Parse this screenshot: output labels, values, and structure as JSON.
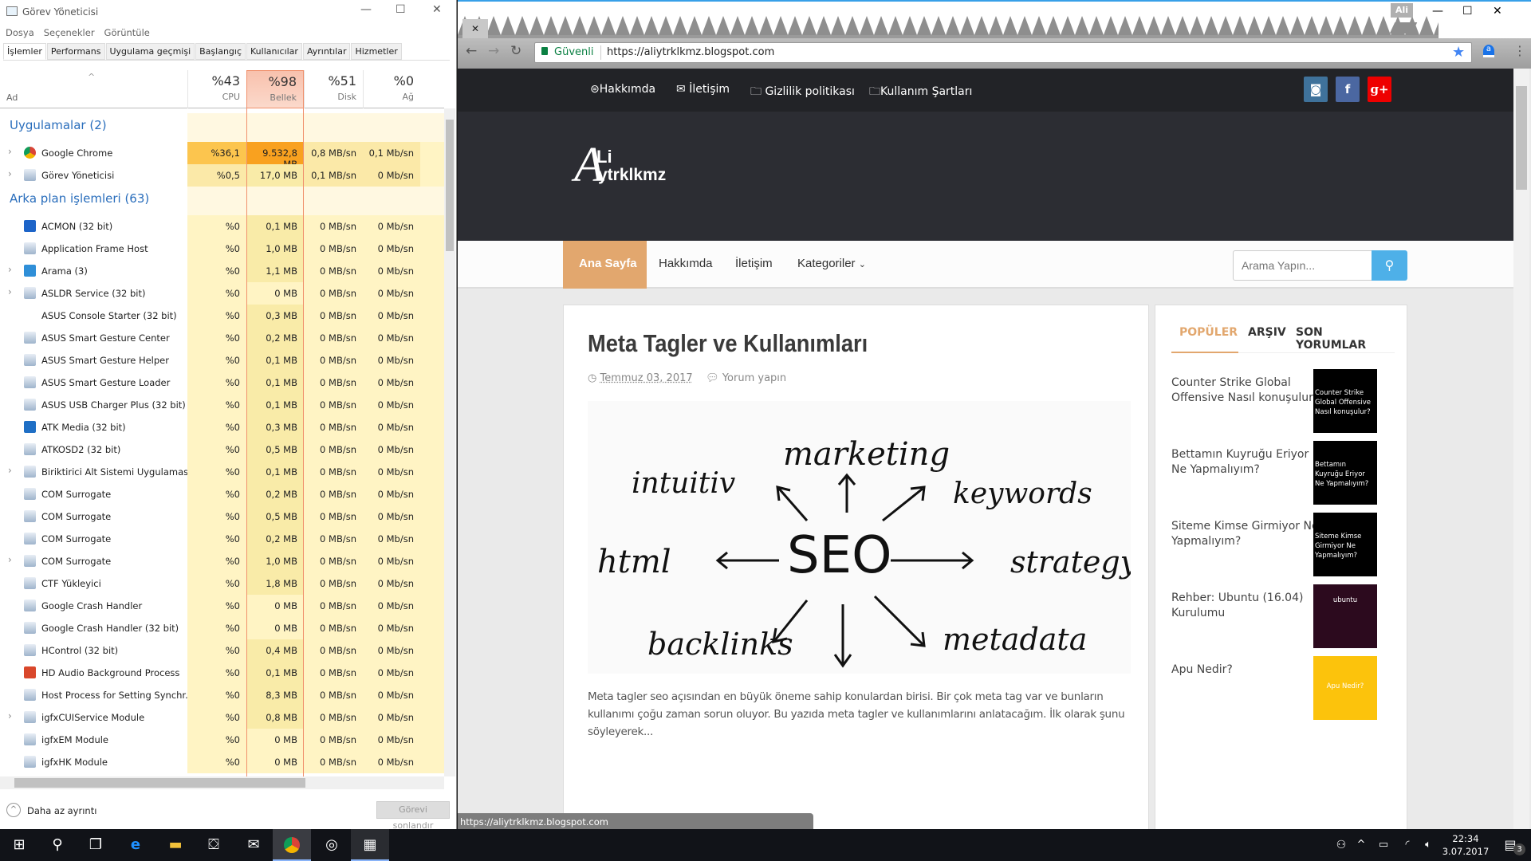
{
  "taskmgr": {
    "title": "Görev Yöneticisi",
    "menu": [
      "Dosya",
      "Seçenekler",
      "Görüntüle"
    ],
    "tabs": [
      "İşlemler",
      "Performans",
      "Uygulama geçmişi",
      "Başlangıç",
      "Kullanıcılar",
      "Ayrıntılar",
      "Hizmetler"
    ],
    "columns": {
      "name": "Ad",
      "cpu": {
        "pct": "%43",
        "label": "CPU"
      },
      "mem": {
        "pct": "%98",
        "label": "Bellek"
      },
      "disk": {
        "pct": "%51",
        "label": "Disk"
      },
      "net": {
        "pct": "%0",
        "label": "Ağ"
      }
    },
    "groups": [
      {
        "title": "Uygulamalar (2)",
        "rows": [
          {
            "name": "Google Chrome",
            "icon": "chrome-icon",
            "expand": true,
            "cpu": "%36,1",
            "mem": "9.532,8 MB",
            "disk": "0,8 MB/sn",
            "net": "0,1 Mb/sn"
          },
          {
            "name": "Görev Yöneticisi",
            "icon": "task-manager-icon",
            "expand": true,
            "cpu": "%0,5",
            "mem": "17,0 MB",
            "disk": "0,1 MB/sn",
            "net": "0 Mb/sn"
          }
        ]
      },
      {
        "title": "Arka plan işlemleri (63)",
        "rows": [
          {
            "name": "ACMON (32 bit)",
            "icon": "acmon-icon",
            "cpu": "%0",
            "mem": "0,1 MB",
            "disk": "0 MB/sn",
            "net": "0 Mb/sn"
          },
          {
            "name": "Application Frame Host",
            "icon": "app-window-icon",
            "cpu": "%0",
            "mem": "1,0 MB",
            "disk": "0 MB/sn",
            "net": "0 Mb/sn"
          },
          {
            "name": "Arama (3)",
            "icon": "search-icon",
            "expand": true,
            "cpu": "%0",
            "mem": "1,1 MB",
            "disk": "0 MB/sn",
            "net": "0 Mb/sn"
          },
          {
            "name": "ASLDR Service (32 bit)",
            "icon": "window-icon",
            "expand": true,
            "cpu": "%0",
            "mem": "0 MB",
            "disk": "0 MB/sn",
            "net": "0 Mb/sn"
          },
          {
            "name": "ASUS Console Starter (32 bit)",
            "icon": "blank-icon",
            "cpu": "%0",
            "mem": "0,3 MB",
            "disk": "0 MB/sn",
            "net": "0 Mb/sn"
          },
          {
            "name": "ASUS Smart Gesture Center",
            "icon": "gesture-icon",
            "cpu": "%0",
            "mem": "0,2 MB",
            "disk": "0 MB/sn",
            "net": "0 Mb/sn"
          },
          {
            "name": "ASUS Smart Gesture Helper",
            "icon": "gesture-icon",
            "cpu": "%0",
            "mem": "0,1 MB",
            "disk": "0 MB/sn",
            "net": "0 Mb/sn"
          },
          {
            "name": "ASUS Smart Gesture Loader",
            "icon": "gesture-loader-icon",
            "cpu": "%0",
            "mem": "0,1 MB",
            "disk": "0 MB/sn",
            "net": "0 Mb/sn"
          },
          {
            "name": "ASUS USB Charger Plus (32 bit)",
            "icon": "usb-icon",
            "cpu": "%0",
            "mem": "0,1 MB",
            "disk": "0 MB/sn",
            "net": "0 Mb/sn"
          },
          {
            "name": "ATK Media (32 bit)",
            "icon": "atk-media-icon",
            "cpu": "%0",
            "mem": "0,3 MB",
            "disk": "0 MB/sn",
            "net": "0 Mb/sn"
          },
          {
            "name": "ATKOSD2 (32 bit)",
            "icon": "atkosd-icon",
            "cpu": "%0",
            "mem": "0,5 MB",
            "disk": "0 MB/sn",
            "net": "0 Mb/sn"
          },
          {
            "name": "Biriktirici Alt Sistemi Uygulaması",
            "icon": "printer-icon",
            "expand": true,
            "cpu": "%0",
            "mem": "0,1 MB",
            "disk": "0 MB/sn",
            "net": "0 Mb/sn"
          },
          {
            "name": "COM Surrogate",
            "icon": "app-window-icon",
            "cpu": "%0",
            "mem": "0,2 MB",
            "disk": "0 MB/sn",
            "net": "0 Mb/sn"
          },
          {
            "name": "COM Surrogate",
            "icon": "app-window-icon",
            "cpu": "%0",
            "mem": "0,5 MB",
            "disk": "0 MB/sn",
            "net": "0 Mb/sn"
          },
          {
            "name": "COM Surrogate",
            "icon": "app-window-icon",
            "cpu": "%0",
            "mem": "0,2 MB",
            "disk": "0 MB/sn",
            "net": "0 Mb/sn"
          },
          {
            "name": "COM Surrogate",
            "icon": "app-window-icon",
            "expand": true,
            "cpu": "%0",
            "mem": "1,0 MB",
            "disk": "0 MB/sn",
            "net": "0 Mb/sn"
          },
          {
            "name": "CTF Yükleyici",
            "icon": "ctf-icon",
            "cpu": "%0",
            "mem": "1,8 MB",
            "disk": "0 MB/sn",
            "net": "0 Mb/sn"
          },
          {
            "name": "Google Crash Handler",
            "icon": "crash-handler-icon",
            "cpu": "%0",
            "mem": "0 MB",
            "disk": "0 MB/sn",
            "net": "0 Mb/sn"
          },
          {
            "name": "Google Crash Handler (32 bit)",
            "icon": "crash-handler-icon",
            "cpu": "%0",
            "mem": "0 MB",
            "disk": "0 MB/sn",
            "net": "0 Mb/sn"
          },
          {
            "name": "HControl (32 bit)",
            "icon": "hcontrol-icon",
            "cpu": "%0",
            "mem": "0,4 MB",
            "disk": "0 MB/sn",
            "net": "0 Mb/sn"
          },
          {
            "name": "HD Audio Background Process",
            "icon": "speaker-icon",
            "cpu": "%0",
            "mem": "0,1 MB",
            "disk": "0 MB/sn",
            "net": "0 Mb/sn"
          },
          {
            "name": "Host Process for Setting Synchr...",
            "icon": "app-window-icon",
            "cpu": "%0",
            "mem": "8,3 MB",
            "disk": "0 MB/sn",
            "net": "0 Mb/sn"
          },
          {
            "name": "igfxCUIService Module",
            "icon": "app-window-icon",
            "expand": true,
            "cpu": "%0",
            "mem": "0,8 MB",
            "disk": "0 MB/sn",
            "net": "0 Mb/sn"
          },
          {
            "name": "igfxEM Module",
            "icon": "app-window-icon",
            "cpu": "%0",
            "mem": "0 MB",
            "disk": "0 MB/sn",
            "net": "0 Mb/sn"
          },
          {
            "name": "igfxHK Module",
            "icon": "app-window-icon",
            "cpu": "%0",
            "mem": "0 MB",
            "disk": "0 MB/sn",
            "net": "0 Mb/sn"
          }
        ]
      }
    ],
    "footer": {
      "fewer_details": "Daha az ayrıntı",
      "end_task": "Görevi sonlandır"
    }
  },
  "browser": {
    "profile": "Ali",
    "secure_label": "Güvenli",
    "url": "https://aliytrklkmz.blogspot.com",
    "status_url": "https://aliytrklkmz.blogspot.com",
    "topnav": [
      "Hakkımda",
      "İletişim",
      "Gizlilik politikası",
      "Kullanım Şartları"
    ],
    "social": [
      {
        "name": "instagram",
        "color": "#3f729b"
      },
      {
        "name": "facebook",
        "color": "#3b5998"
      },
      {
        "name": "google-plus",
        "color": "#ee0000"
      }
    ],
    "logo": {
      "big": "A",
      "top": "Li",
      "bottom": "ytrklkmz"
    },
    "nav": [
      "Ana Sayfa",
      "Hakkımda",
      "İletişim",
      "Kategoriler"
    ],
    "accent": "#e2a76e",
    "search_placeholder": "Arama Yapın...",
    "post": {
      "title": "Meta Tagler ve Kullanımları",
      "date": "Temmuz 03, 2017",
      "comments": "Yorum yapın",
      "image_words": [
        "SEO",
        "marketing",
        "intuitiv",
        "keywords",
        "html",
        "strategy",
        "backlinks",
        "metadata"
      ],
      "excerpt": "Meta tagler seo açısından en büyük öneme sahip konulardan birisi. Bir çok meta tag var ve bunların kullanımı çoğu zaman sorun oluyor. Bu yazıda meta tagler ve kullanımlarını anlatacağım.  İlk olarak şunu söyleyerek..."
    },
    "sidebar": {
      "tabs": [
        "POPÜLER",
        "ARŞIV",
        "SON YORUMLAR"
      ],
      "items": [
        {
          "title": "Counter Strike Global Offensive Nasıl konuşulur?",
          "thumb": "Counter Strike Global Offensive Nasıl konuşulur?",
          "bg": "#000000"
        },
        {
          "title": "Bettamın Kuyruğu Eriyor Ne Yapmalıyım?",
          "thumb": "Bettamın Kuyruğu Eriyor Ne Yapmalıyım?",
          "bg": "#000000"
        },
        {
          "title": "Siteme Kimse Girmiyor Ne Yapmalıyım?",
          "thumb": "Siteme Kimse Girmiyor Ne Yapmalıyım?",
          "bg": "#000000"
        },
        {
          "title": "Rehber: Ubuntu (16.04) Kurulumu",
          "thumb": "ubuntu",
          "bg": "#2c0a1e"
        },
        {
          "title": "Apu Nedir?",
          "thumb": "Apu Nedir?",
          "bg": "#fcc30c"
        }
      ]
    }
  },
  "taskbar": {
    "time": "22:34",
    "date": "3.07.2017",
    "notifications": "3"
  }
}
